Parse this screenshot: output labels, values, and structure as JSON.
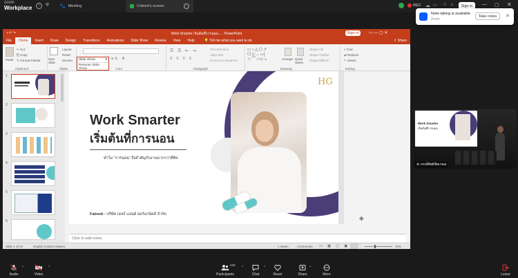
{
  "zoom": {
    "brand_top": "zoom",
    "brand_bottom": "Workplace",
    "tabs": [
      "Meeting",
      "Coboot's screen"
    ],
    "rec_label": "REC",
    "sign_in": "Sign in",
    "participants_count": "233",
    "toolbar": {
      "audio": "Audio",
      "video": "Video",
      "participants": "Participants",
      "chat": "Chat",
      "react": "React",
      "share": "Share",
      "more": "More",
      "leave": "Leave"
    }
  },
  "notification": {
    "title": "Note-taking is available",
    "subtitle": "Zoom",
    "button": "Take notes"
  },
  "ppt": {
    "title": "Work Smarter เริ่มต้นที่การนอน... - PowerPoint",
    "sign_in": "Sign in",
    "share": "Share",
    "tell_me": "Tell me what you want to do",
    "menu": [
      "File",
      "Home",
      "Insert",
      "Draw",
      "Design",
      "Transitions",
      "Animations",
      "Slide Show",
      "Review",
      "View",
      "Help"
    ],
    "ribbon": {
      "paste": "Paste",
      "cut": "Cut",
      "copy": "Copy",
      "format_painter": "Format Painter",
      "new_slide": "New Slide",
      "layout": "Layout",
      "reset": "Reset",
      "section": "Section",
      "text_direction": "Text Direction",
      "align_text": "Align Text",
      "convert_smartart": "Convert to SmartArt",
      "arrange": "Arrange",
      "quick_styles": "Quick Styles",
      "shape_fill": "Shape Fill",
      "shape_outline": "Shape Outline",
      "shape_effects": "Shape Effects",
      "find": "Find",
      "replace": "Replace",
      "select": "Select",
      "groups": [
        "Clipboard",
        "Slides",
        "Font",
        "Paragraph",
        "Drawing",
        "Editing"
      ]
    },
    "dropdown": {
      "value": "Slide Show",
      "option": "Resume Slide Show"
    },
    "slide_numbers": [
      "1",
      "2",
      "3",
      "4",
      "5",
      "6"
    ],
    "slide": {
      "title": "Work Smarter",
      "title_thai": "เริ่มต้นที่การนอน",
      "subtitle": "ทำไม \"การนอน\" ถึงสำคัญกับงานมากกว่าที่คิด",
      "footer_label": "Fabook :",
      "footer_text": "บริษัท เฮลธ์ แอนด์ ออร์แกนิคส์ จำกัด",
      "logo": "HG"
    },
    "notes_placeholder": "Click to add notes",
    "status": {
      "slide_info": "Slide 1 of 24",
      "language": "English (United States)",
      "notes": "Notes",
      "comments": "Comments",
      "zoom": "70%"
    }
  },
  "video": {
    "thumb_title": "Work Smarter",
    "thumb_subtitle": "เริ่มต้นที่การนอน",
    "caption": "ภรณ์ทิพย์ชัยเกษม"
  },
  "colors": {
    "ppt_red": "#c43e1c",
    "purple": "#4a3d78",
    "teal": "#5fc7c7"
  }
}
